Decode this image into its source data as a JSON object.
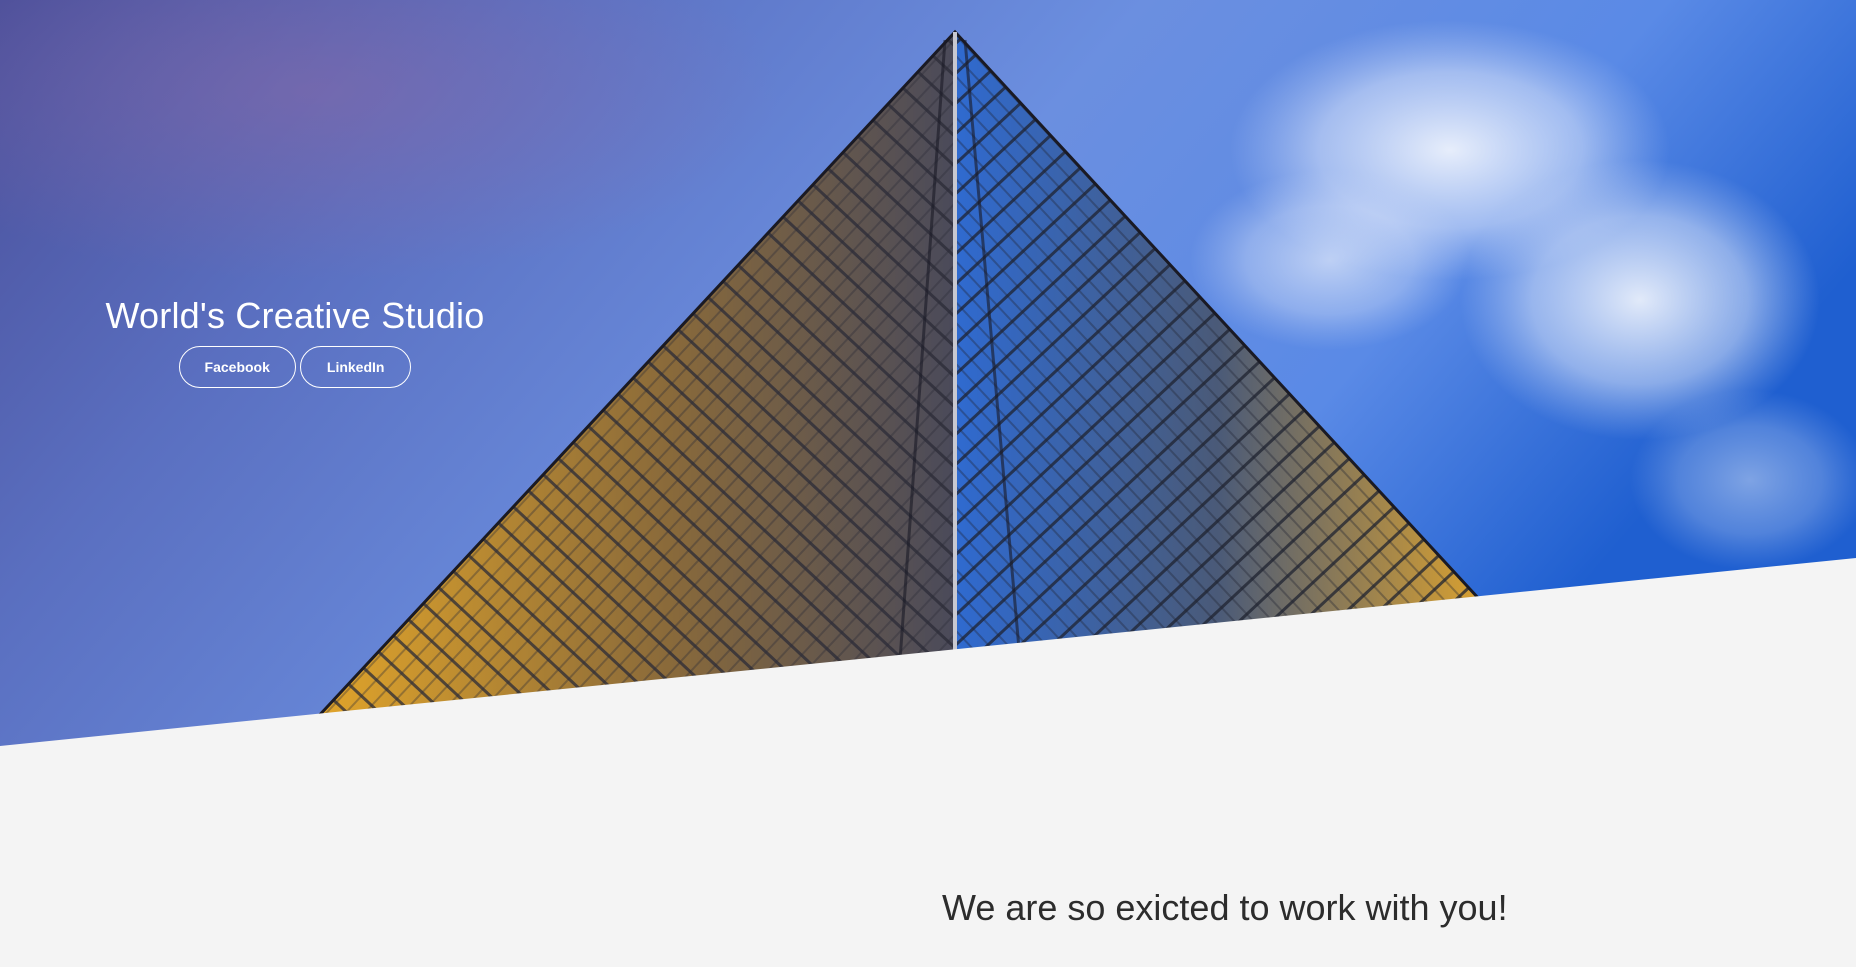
{
  "hero": {
    "title": "World's Creative Studio",
    "buttons": {
      "facebook": "Facebook",
      "linkedin": "LinkedIn"
    },
    "image": "skyscraper-photo",
    "colors": {
      "sky_top_left": "#4d5aa8",
      "sky_right": "#4f86e4",
      "facade_gold": "#e0a030",
      "glass_blue": "#2f6fd0"
    }
  },
  "content": {
    "tagline": "We are so exicted to work with you!"
  },
  "theme": {
    "background": "#f4f4f4",
    "text": "#2c2c2c"
  }
}
